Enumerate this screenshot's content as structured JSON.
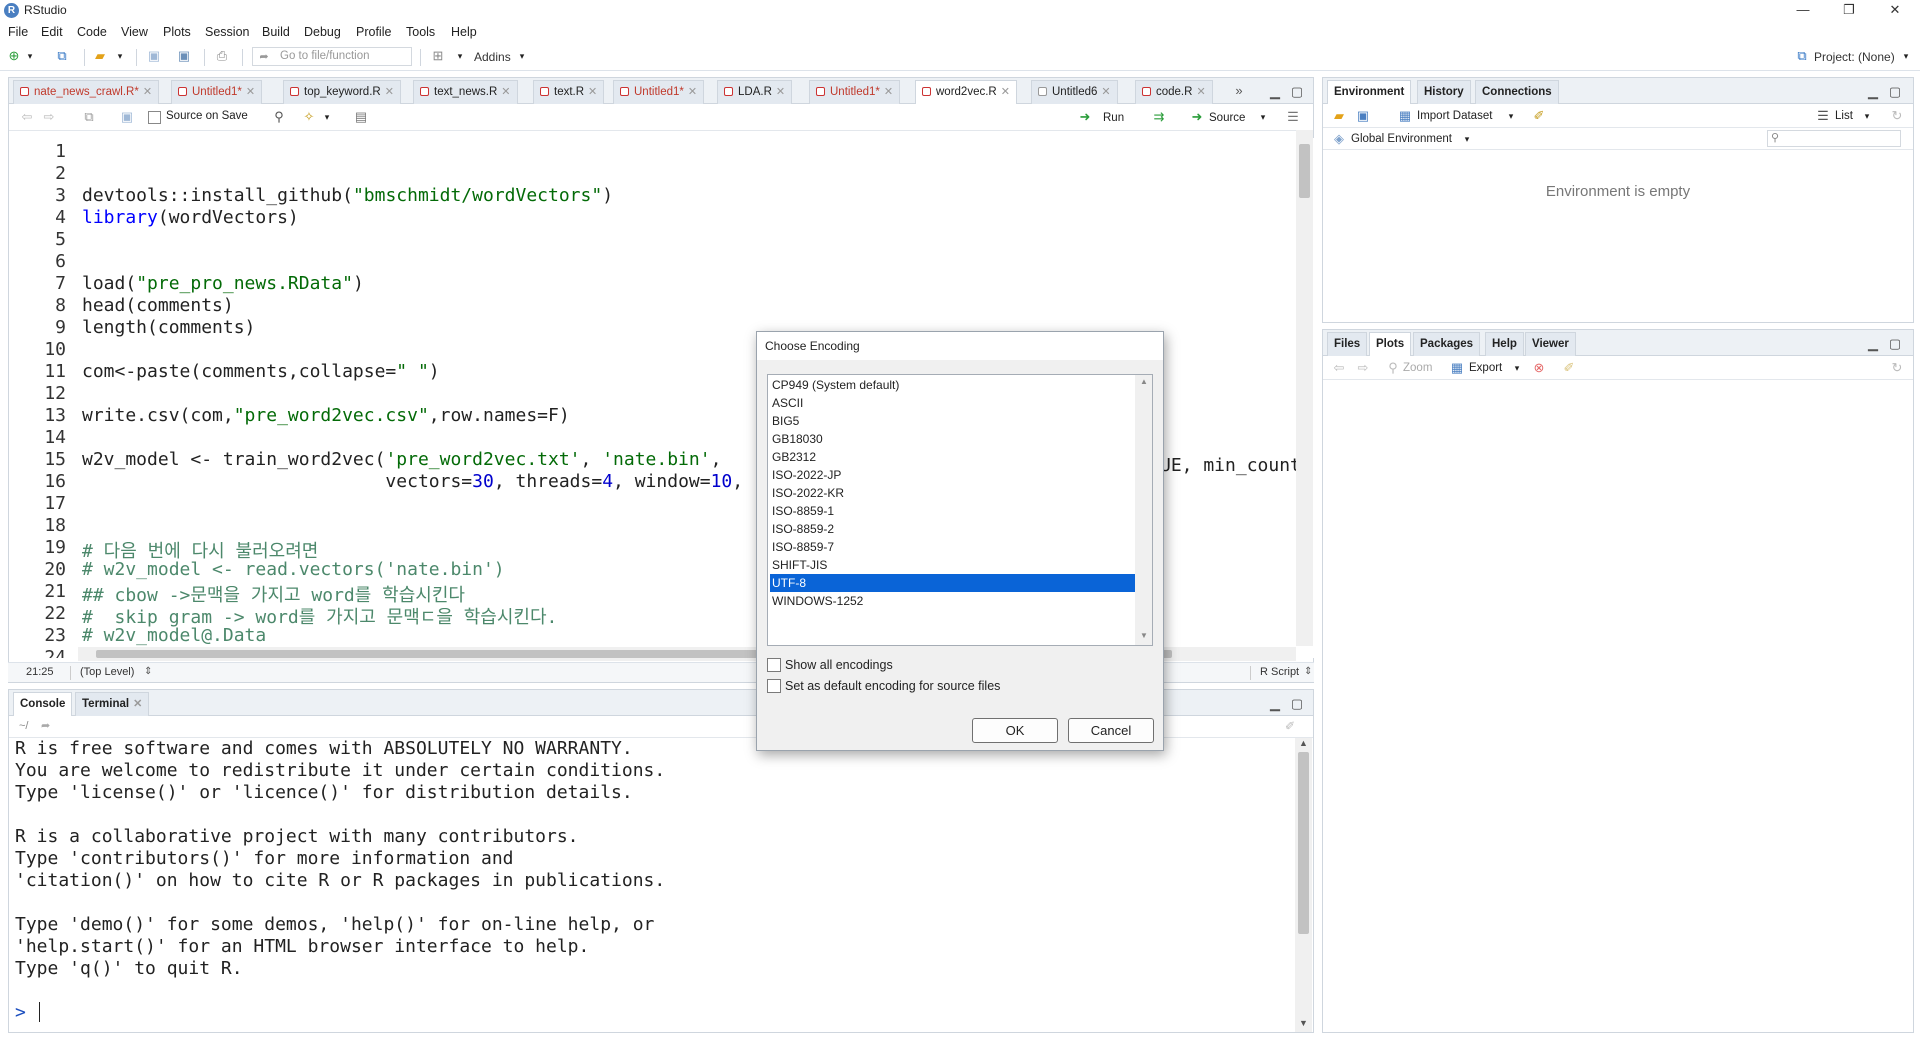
{
  "window": {
    "title": "RStudio",
    "minimize": "—",
    "maximize": "❐",
    "close": "✕"
  },
  "menu": [
    "File",
    "Edit",
    "Code",
    "View",
    "Plots",
    "Session",
    "Build",
    "Debug",
    "Profile",
    "Tools",
    "Help"
  ],
  "toolbar": {
    "goto_placeholder": "Go to file/function",
    "addins": "Addins",
    "project": "Project: (None)"
  },
  "editor": {
    "tabs": [
      {
        "label": "nate_news_crawl.R*",
        "unsaved": true
      },
      {
        "label": "Untitled1*",
        "unsaved": true
      },
      {
        "label": "top_keyword.R",
        "unsaved": false
      },
      {
        "label": "text_news.R",
        "unsaved": false
      },
      {
        "label": "text.R",
        "unsaved": false
      },
      {
        "label": "Untitled1*",
        "unsaved": true
      },
      {
        "label": "LDA.R",
        "unsaved": false
      },
      {
        "label": "Untitled1*",
        "unsaved": true
      },
      {
        "label": "word2vec.R",
        "unsaved": false,
        "active": true
      },
      {
        "label": "Untitled6",
        "unsaved": false
      },
      {
        "label": "code.R",
        "unsaved": false
      }
    ],
    "source_on_save": "Source on Save",
    "run": "Run",
    "source": "Source",
    "lines": [
      {
        "n": "1",
        "t": ""
      },
      {
        "n": "2",
        "t": ""
      },
      {
        "n": "3",
        "t": "devtools::install_github(\"bmschmidt/wordVectors\")"
      },
      {
        "n": "4",
        "t": "library(wordVectors)"
      },
      {
        "n": "5",
        "t": ""
      },
      {
        "n": "6",
        "t": ""
      },
      {
        "n": "7",
        "t": "load(\"pre_pro_news.RData\")"
      },
      {
        "n": "8",
        "t": "head(comments)"
      },
      {
        "n": "9",
        "t": "length(comments)"
      },
      {
        "n": "10",
        "t": ""
      },
      {
        "n": "11",
        "t": "com<-paste(comments,collapse=\" \")"
      },
      {
        "n": "12",
        "t": ""
      },
      {
        "n": "13",
        "t": "write.csv(com,\"pre_word2vec.csv\",row.names=F)"
      },
      {
        "n": "14",
        "t": ""
      },
      {
        "n": "15",
        "t": "w2v_model <- train_word2vec('pre_word2vec.txt', 'nate.bin',"
      },
      {
        "n": "16",
        "t": "                            vectors=30, threads=4, window=10,"
      },
      {
        "n": "17",
        "t": ""
      },
      {
        "n": "18",
        "t": ""
      },
      {
        "n": "19",
        "t": "# 다음 번에 다시 불러오려면"
      },
      {
        "n": "20",
        "t": "# w2v_model <- read.vectors('nate.bin')"
      },
      {
        "n": "21",
        "t": "## cbow ->문맥을 가지고 word를 학습시킨다"
      },
      {
        "n": "22",
        "t": "#  skip gram -> word를 가지고 문맥ㄷ을 학습시킨다."
      },
      {
        "n": "23",
        "t": "# w2v_model@.Data"
      },
      {
        "n": "24",
        "t": ""
      }
    ],
    "line16_tail": "UE, min_count",
    "status_pos": "21:25",
    "status_scope": "(Top Level)",
    "status_type": "R Script"
  },
  "console": {
    "tabs": [
      "Console",
      "Terminal"
    ],
    "path": "~/",
    "lines": [
      "R is free software and comes with ABSOLUTELY NO WARRANTY.",
      "You are welcome to redistribute it under certain conditions.",
      "Type 'license()' or 'licence()' for distribution details.",
      "",
      "R is a collaborative project with many contributors.",
      "Type 'contributors()' for more information and",
      "'citation()' on how to cite R or R packages in publications.",
      "",
      "Type 'demo()' for some demos, 'help()' for on-line help, or",
      "'help.start()' for an HTML browser interface to help.",
      "Type 'q()' to quit R.",
      ""
    ],
    "prompt": ">"
  },
  "environment": {
    "tabs": [
      "Environment",
      "History",
      "Connections"
    ],
    "import_dataset": "Import Dataset",
    "list_label": "List",
    "scope": "Global Environment",
    "empty_msg": "Environment is empty"
  },
  "files": {
    "tabs": [
      "Files",
      "Plots",
      "Packages",
      "Help",
      "Viewer"
    ],
    "zoom": "Zoom",
    "export": "Export"
  },
  "dialog": {
    "title": "Choose Encoding",
    "encodings": [
      "CP949 (System default)",
      "ASCII",
      "BIG5",
      "GB18030",
      "GB2312",
      "ISO-2022-JP",
      "ISO-2022-KR",
      "ISO-8859-1",
      "ISO-8859-2",
      "ISO-8859-7",
      "SHIFT-JIS",
      "UTF-8",
      "WINDOWS-1252"
    ],
    "selected": "UTF-8",
    "show_all": "Show all encodings",
    "set_default": "Set as default encoding for source files",
    "ok": "OK",
    "cancel": "Cancel"
  },
  "colors": {
    "accent": "#0a64d7",
    "string": "#036a07",
    "number": "#0000cd",
    "comment": "#4c886b",
    "unsaved": "#c0392b"
  }
}
